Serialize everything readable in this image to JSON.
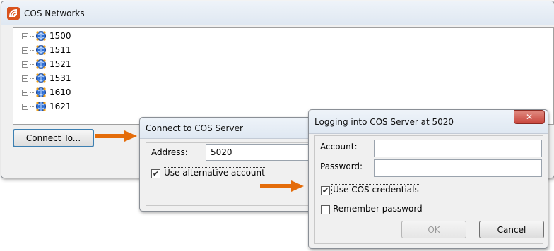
{
  "main_window": {
    "title": "COS Networks",
    "networks": [
      "1500",
      "1511",
      "1521",
      "1531",
      "1610",
      "1621"
    ],
    "connect_button": "Connect To..."
  },
  "connect_dialog": {
    "title": "Connect to COS Server",
    "address_label": "Address:",
    "address_value": "5020",
    "alt_account_label": "Use alternative account",
    "alt_account_checked": true
  },
  "login_dialog": {
    "title": "Logging into COS Server at 5020",
    "account_label": "Account:",
    "account_value": "",
    "password_label": "Password:",
    "password_value": "",
    "use_cos_label": "Use COS credentials",
    "use_cos_checked": true,
    "remember_label": "Remember password",
    "remember_checked": false,
    "ok_button": "OK",
    "cancel_button": "Cancel",
    "close_glyph": "✕"
  },
  "icons": {
    "app": "cos-app-icon",
    "network": "globe-network-icon",
    "expand": "plus-expander-icon",
    "arrow": "orange-arrow-icon"
  },
  "colors": {
    "arrow": "#e46c0a",
    "close_button": "#c9463d",
    "connect_button_border": "#3c7fb1"
  }
}
